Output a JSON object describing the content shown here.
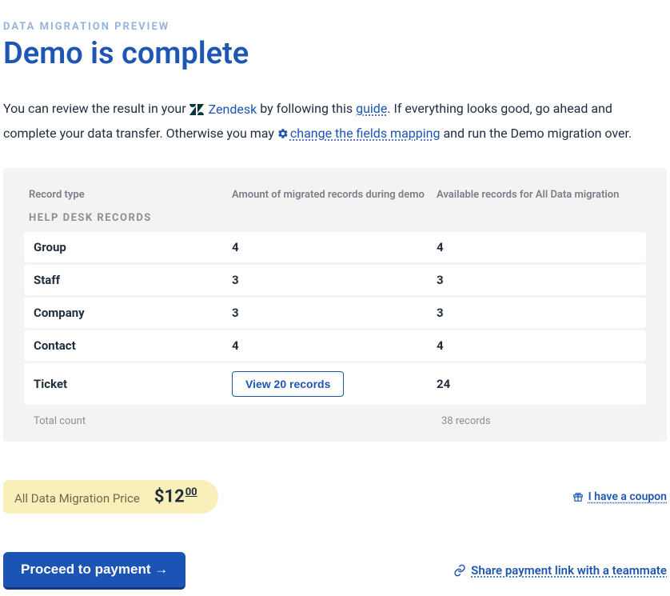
{
  "eyebrow": "DATA MIGRATION PREVIEW",
  "title": "Demo is complete",
  "desc": {
    "p1a": "You can review the result in your",
    "platform": "Zendesk",
    "p1b": "by following this",
    "guide_link": "guide",
    "p1c": ". If everything looks good, go ahead and complete your data transfer. Otherwise you may",
    "change_link": "change the fields mapping",
    "p1d": "and run the Demo migration over."
  },
  "headers": {
    "c1": "Record type",
    "c2": "Amount of migrated records during demo",
    "c3": "Available records for All Data migration"
  },
  "section_label": "HELP DESK RECORDS",
  "rows": [
    {
      "type": "Group",
      "amt": "4",
      "avail": "4"
    },
    {
      "type": "Staff",
      "amt": "3",
      "avail": "3"
    },
    {
      "type": "Company",
      "amt": "3",
      "avail": "3"
    },
    {
      "type": "Contact",
      "amt": "4",
      "avail": "4"
    }
  ],
  "ticket_row": {
    "type": "Ticket",
    "btn": "View 20 records",
    "avail": "24"
  },
  "totals": {
    "label": "Total count",
    "value": "38 records"
  },
  "price": {
    "label": "All Data Migration Price",
    "currency": "$",
    "whole": "12",
    "cents": "00"
  },
  "coupon": "I have a coupon",
  "cta": "Proceed to payment  →",
  "share": "Share payment link with a teammate"
}
